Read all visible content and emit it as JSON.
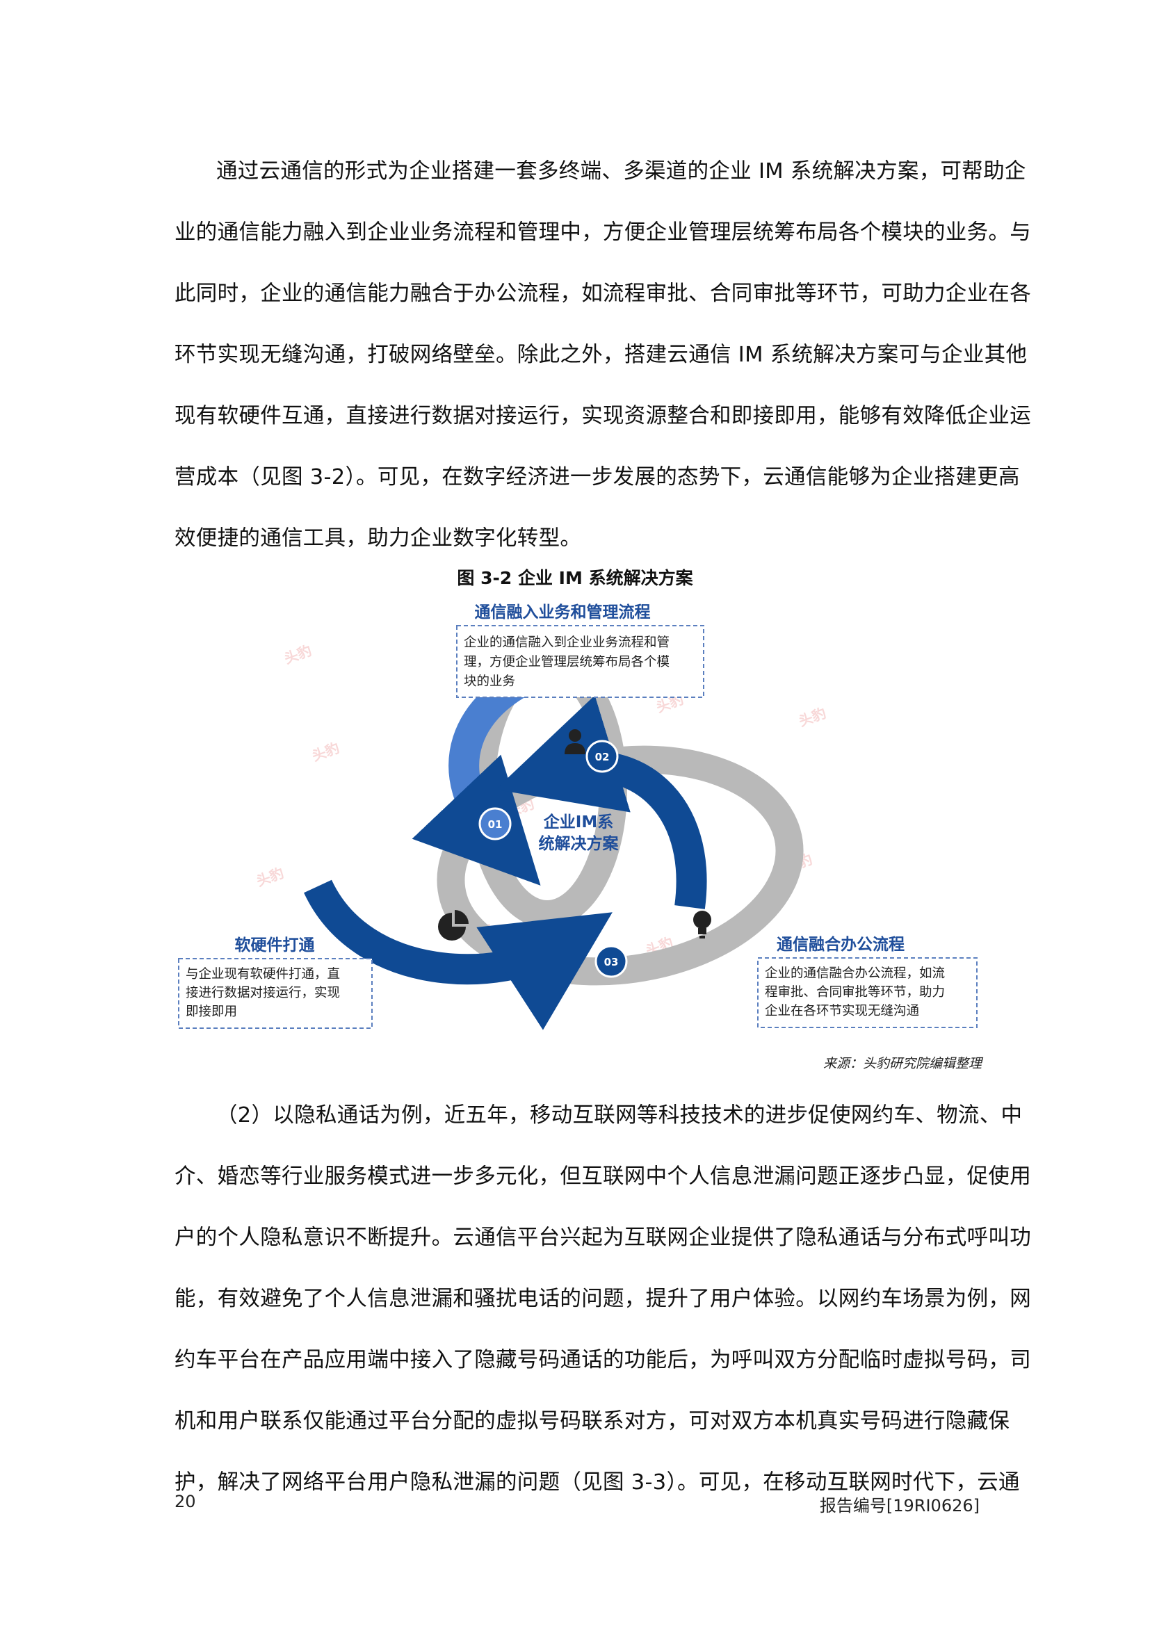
{
  "paragraph1": [
    "通过云通信的形式为企业搭建一套多终端、多渠道的企业 IM 系统解决方案，可帮助企",
    "业的通信能力融入到企业业务流程和管理中，方便企业管理层统筹布局各个模块的业务。与",
    "此同时，企业的通信能力融合于办公流程，如流程审批、合同审批等环节，可助力企业在各",
    "环节实现无缝沟通，打破网络壁垒。除此之外，搭建云通信 IM 系统解决方案可与企业其他",
    "现有软硬件互通，直接进行数据对接运行，实现资源整合和即接即用，能够有效降低企业运",
    "营成本（见图 3-2）。可见，在数字经济进一步发展的态势下，云通信能够为企业搭建更高",
    "效便捷的通信工具，助力企业数字化转型。"
  ],
  "figure": {
    "caption": "图 3-2  企业 IM 系统解决方案",
    "center_label_line1": "企业IM系",
    "center_label_line2": "统解决方案",
    "steps": [
      "01",
      "02",
      "03"
    ],
    "top_box": {
      "title": "通信融入业务和管理流程",
      "lines": [
        "企业的通信融入到企业业务流程和管",
        "理，方便企业管理层统筹布局各个模",
        "块的业务"
      ]
    },
    "left_box": {
      "title": "软硬件打通",
      "lines": [
        "与企业现有软硬件打通，直",
        "接进行数据对接运行，实现",
        "即接即用"
      ]
    },
    "right_box": {
      "title": "通信融合办公流程",
      "lines": [
        "企业的通信融合办公流程，如流",
        "程审批、合同审批等环节，助力",
        "企业在各环节实现无缝沟通"
      ]
    },
    "watermark_text": "头豹",
    "icons": [
      "user-icon",
      "pie-chart-icon",
      "lightbulb-icon"
    ],
    "colors": {
      "blue_light": "#4a7fd0",
      "blue_dark": "#0f4a94",
      "gray": "#b9b9b9",
      "title_blue": "#1f4e9b",
      "box_border": "#5b7fbf"
    }
  },
  "source": "来源：头豹研究院编辑整理",
  "paragraph2": [
    "（2）以隐私通话为例，近五年，移动互联网等科技技术的进步促使网约车、物流、中",
    "介、婚恋等行业服务模式进一步多元化，但互联网中个人信息泄漏问题正逐步凸显，促使用",
    "户的个人隐私意识不断提升。云通信平台兴起为互联网企业提供了隐私通话与分布式呼叫功",
    "能，有效避免了个人信息泄漏和骚扰电话的问题，提升了用户体验。以网约车场景为例，网",
    "约车平台在产品应用端中接入了隐藏号码通话的功能后，为呼叫双方分配临时虚拟号码，司",
    "机和用户联系仅能通过平台分配的虚拟号码联系对方，可对双方本机真实号码进行隐藏保",
    "护，解决了网络平台用户隐私泄漏的问题（见图 3-3）。可见，在移动互联网时代下，云通"
  ],
  "footer": {
    "page_number": "20",
    "report_number": "报告编号[19RI0626]"
  }
}
